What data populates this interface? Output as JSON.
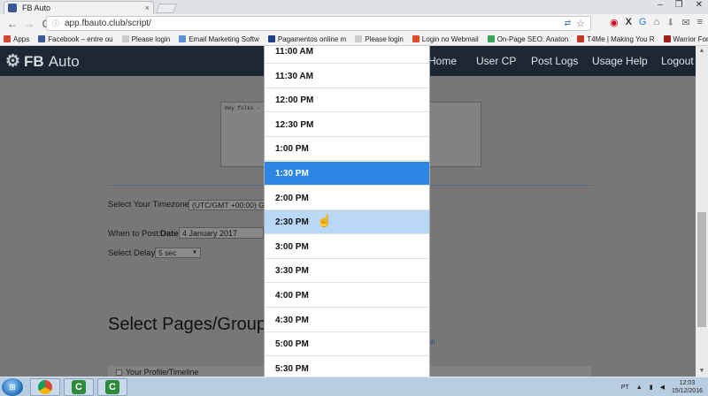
{
  "browser": {
    "tab_title": "FB Auto",
    "tab_close": "×",
    "window_controls": [
      "–",
      "❐",
      "✕"
    ],
    "nav": {
      "back": "←",
      "forward": "→",
      "reload": "C"
    },
    "url": "app.fbauto.club/script/",
    "bookmarks": [
      {
        "label": "Apps",
        "icon_color": "#d34836"
      },
      {
        "label": "Facebook – entre ou",
        "icon_color": "#3b5998"
      },
      {
        "label": "Please login",
        "icon_color": "#cccccc"
      },
      {
        "label": "Email Marketing Softw",
        "icon_color": "#5b8fd6"
      },
      {
        "label": "Pagamentos online m",
        "icon_color": "#1f3f8a"
      },
      {
        "label": "Please login",
        "icon_color": "#cccccc"
      },
      {
        "label": "Login no Webmail",
        "icon_color": "#e04a2a"
      },
      {
        "label": "On-Page SEO: Anaton",
        "icon_color": "#3aa65a"
      },
      {
        "label": "T4Me | Making You R",
        "icon_color": "#c0392b"
      },
      {
        "label": "Warrior Forum - The",
        "icon_color": "#a02020"
      }
    ]
  },
  "site": {
    "logo_fb": "FB",
    "logo_auto": "Auto",
    "menu": [
      "Home",
      "User CP",
      "Post Logs",
      "Usage Help",
      "Logout"
    ]
  },
  "form": {
    "message_text": "Hey folks -",
    "timezone_label": "Select Your Timezone:",
    "timezone_value": "(UTC/GMT +00:00) G",
    "when_label": "When to Post:",
    "date_label": "Date",
    "date_value": "4 January 2017",
    "delay_label": "Select Delay:",
    "delay_value": "5 sec",
    "section_title": "Select Pages/Groups",
    "select_all_link": "all",
    "row_label": "Your Profile/Timeline"
  },
  "dropdown": {
    "options": [
      "11:00 AM",
      "11:30 AM",
      "12:00 PM",
      "12:30 PM",
      "1:00 PM",
      "1:30 PM",
      "2:00 PM",
      "2:30 PM",
      "3:00 PM",
      "3:30 PM",
      "4:00 PM",
      "4:30 PM",
      "5:00 PM",
      "5:30 PM"
    ],
    "selected": "1:30 PM",
    "hovered": "2:30 PM"
  },
  "taskbar": {
    "lang": "PT",
    "time": "12:03",
    "date": "15/12/2016"
  },
  "colors": {
    "navbar": "#1d2733",
    "selected_option": "#2b87e3",
    "hover_option": "#b8d8f6"
  }
}
